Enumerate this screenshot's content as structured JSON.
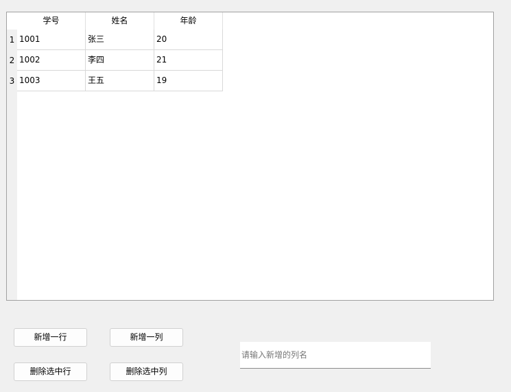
{
  "table": {
    "headers": [
      "学号",
      "姓名",
      "年龄"
    ],
    "row_numbers": [
      "1",
      "2",
      "3"
    ],
    "rows": [
      [
        "1001",
        "张三",
        "20"
      ],
      [
        "1002",
        "李四",
        "21"
      ],
      [
        "1003",
        "王五",
        "19"
      ]
    ]
  },
  "buttons": {
    "add_row": "新增一行",
    "add_column": "新增一列",
    "delete_row": "删除选中行",
    "delete_column": "删除选中列"
  },
  "column_input": {
    "placeholder": "请输入新增的列名",
    "value": ""
  }
}
